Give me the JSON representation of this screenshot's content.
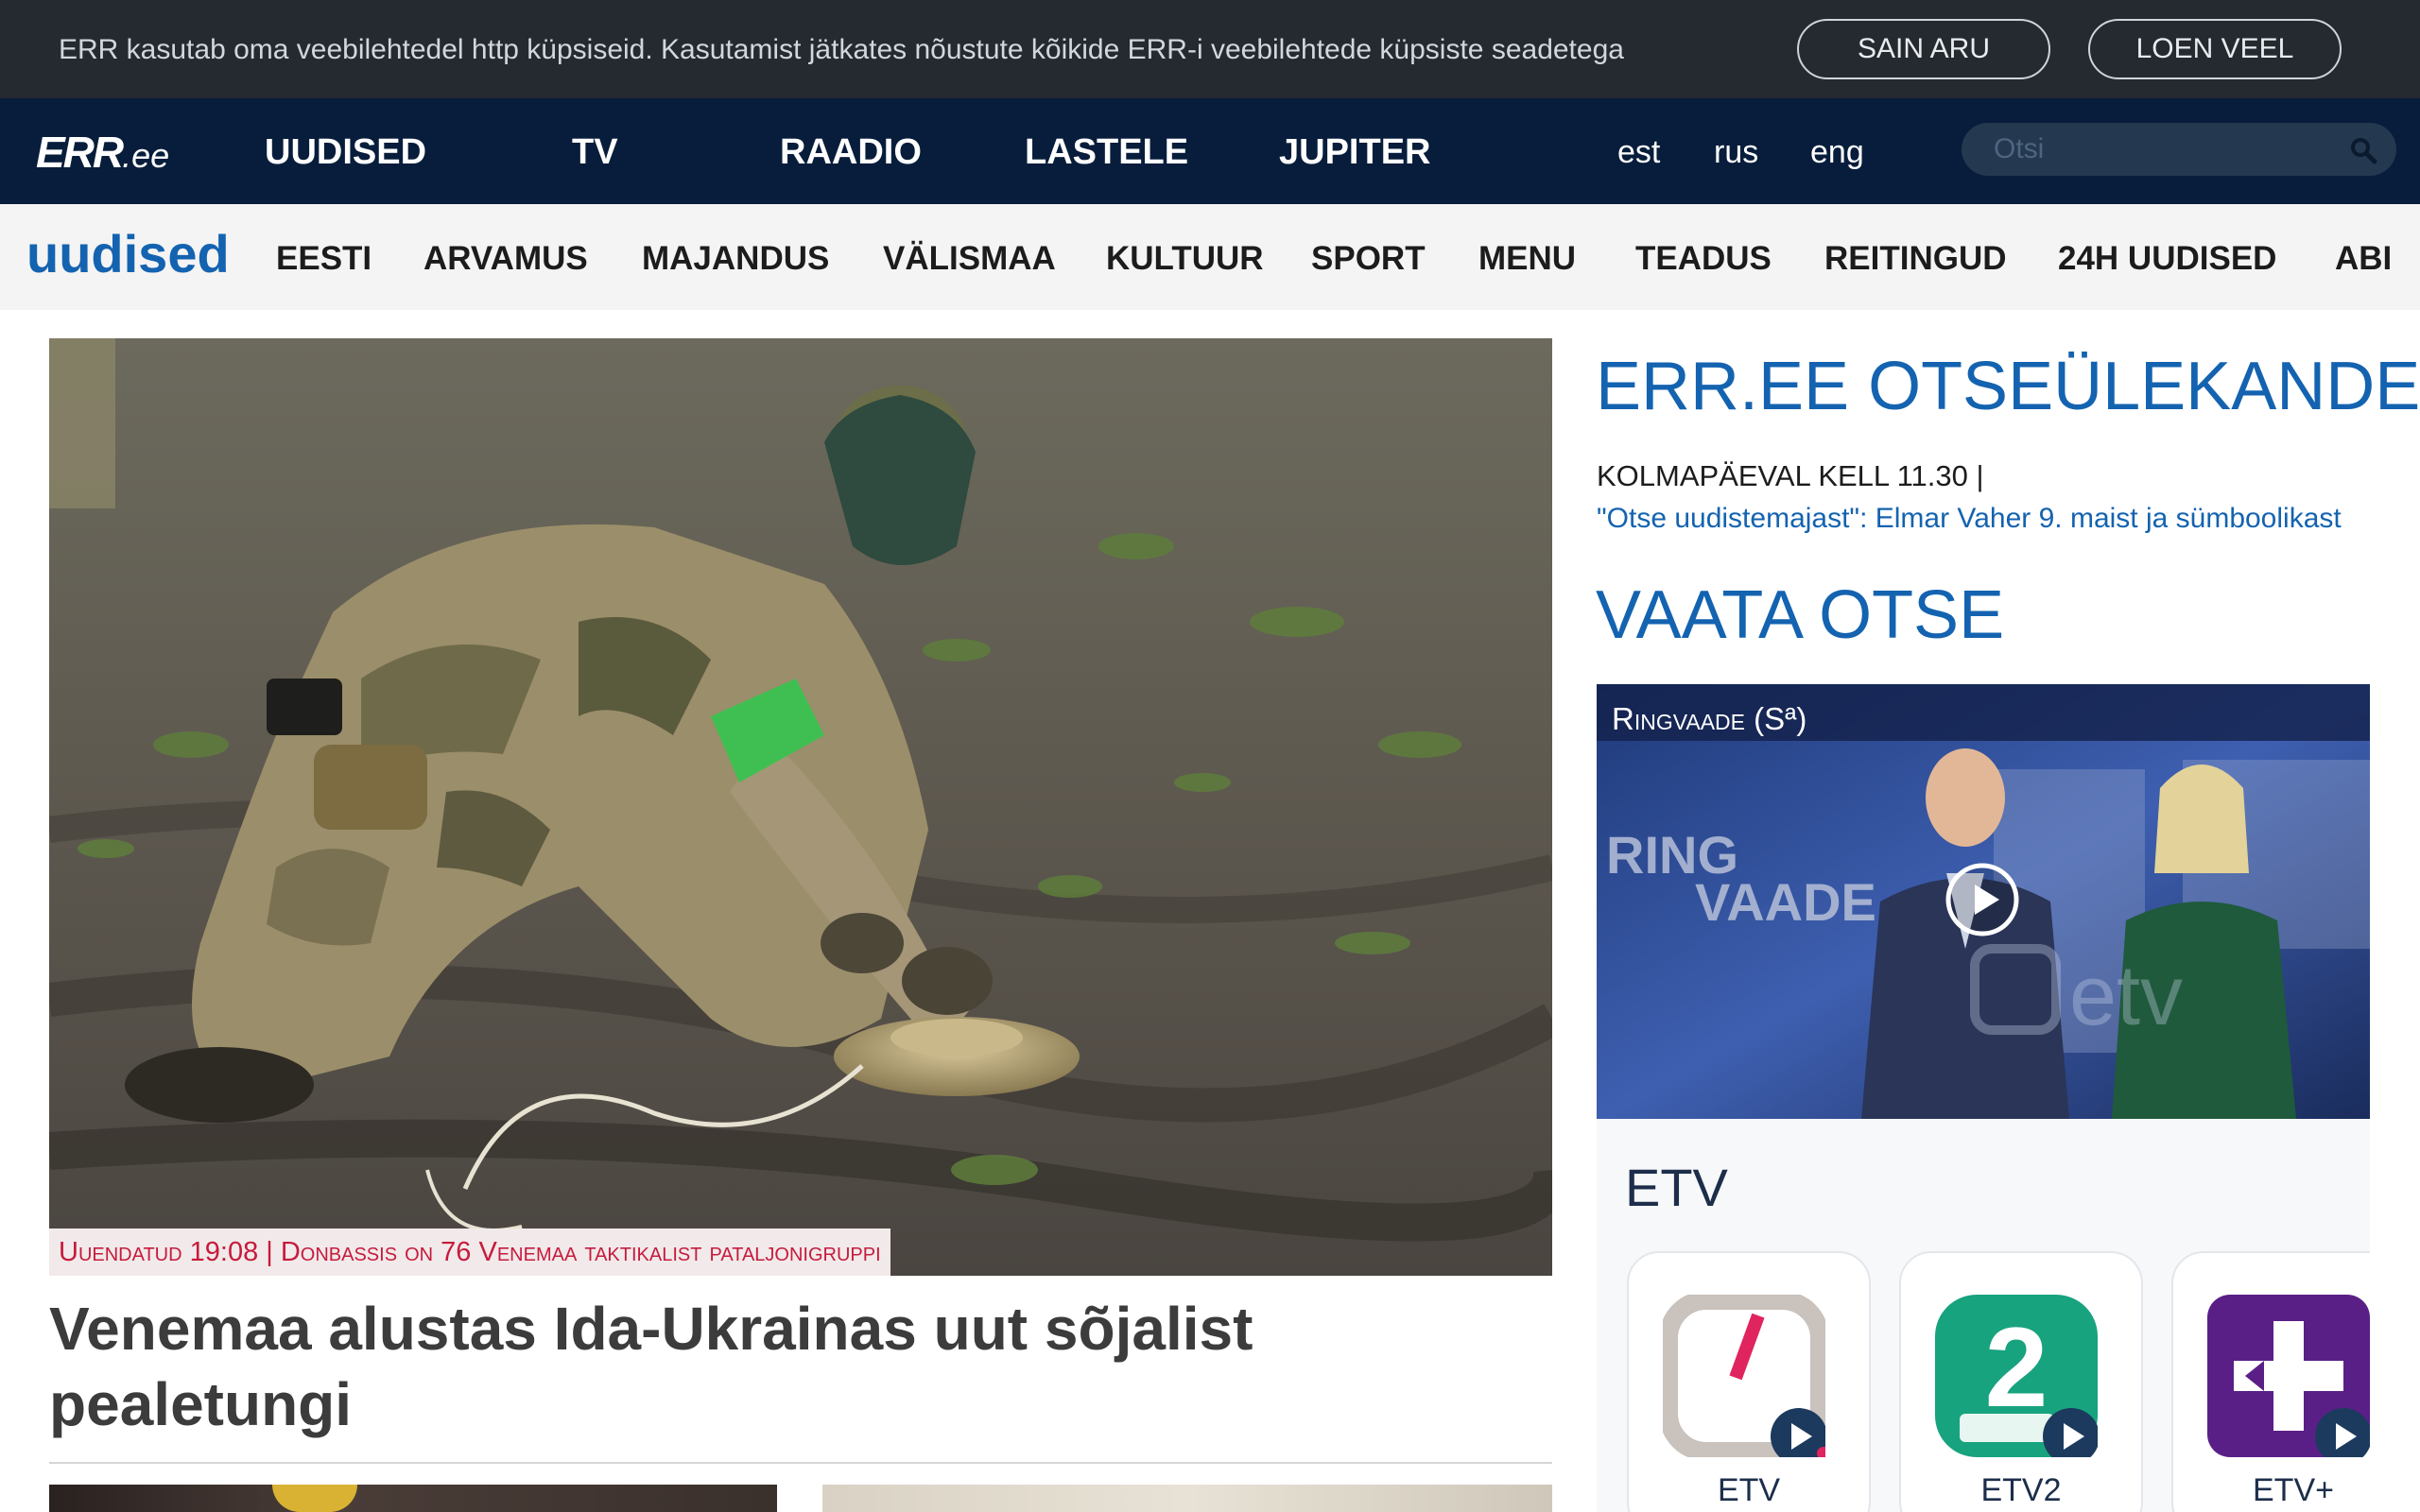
{
  "cookie_bar": {
    "text": "ERR kasutab oma veebilehtedel http küpsiseid. Kasutamist jätkates nõustute kõikide ERR-i veebilehtede küpsiste seadetega",
    "accept_label": "SAIN ARU",
    "more_label": "LOEN VEEL"
  },
  "topnav": {
    "logo_main": "ERR",
    "logo_suffix": ".ee",
    "items": [
      "UUDISED",
      "TV",
      "RAADIO",
      "LASTELE",
      "JUPITER"
    ],
    "languages": [
      "est",
      "rus",
      "eng"
    ],
    "search_placeholder": "Otsi"
  },
  "section_nav": {
    "title": "uudised",
    "items": [
      "EESTI",
      "ARVAMUS",
      "MAJANDUS",
      "VÄLISMAA",
      "KULTUUR",
      "SPORT",
      "MENU",
      "TEADUS",
      "REITINGUD",
      "24H UUDISED",
      "ABI"
    ]
  },
  "hero": {
    "caption": "Uuendatud 19:08 | Donbassis on 76 Venemaa taktikalist pataljonigruppi",
    "headline": "Venemaa alustas Ida-Ukrainas uut sõjalist pealetungi"
  },
  "live": {
    "title": "ERR.EE OTSEÜLEKANDED",
    "time": "KOLMAPÄEVAL KELL 11.30 |",
    "link": "\"Otse uudistemajast\": Elmar Vaher 9. maist ja sümboolikast"
  },
  "watch": {
    "title": "VAATA OTSE",
    "video_label": "Ringvaade (Sª)",
    "studio_text_1": "RING",
    "studio_text_2": "VAADE",
    "watermark": "etv"
  },
  "channels": {
    "heading": "ETV",
    "items": [
      {
        "name": "ETV",
        "icon": "etv-logo-icon",
        "color": "#c9c2bd"
      },
      {
        "name": "ETV2",
        "icon": "etv2-logo-icon",
        "color": "#17a37e"
      },
      {
        "name": "ETV+",
        "icon": "etvplus-logo-icon",
        "color": "#5a1f86"
      }
    ]
  },
  "colors": {
    "accent_blue": "#1463b0",
    "nav_bg": "#071d3b",
    "cookie_bg": "#252a31",
    "caption_red": "#c61b3c"
  }
}
